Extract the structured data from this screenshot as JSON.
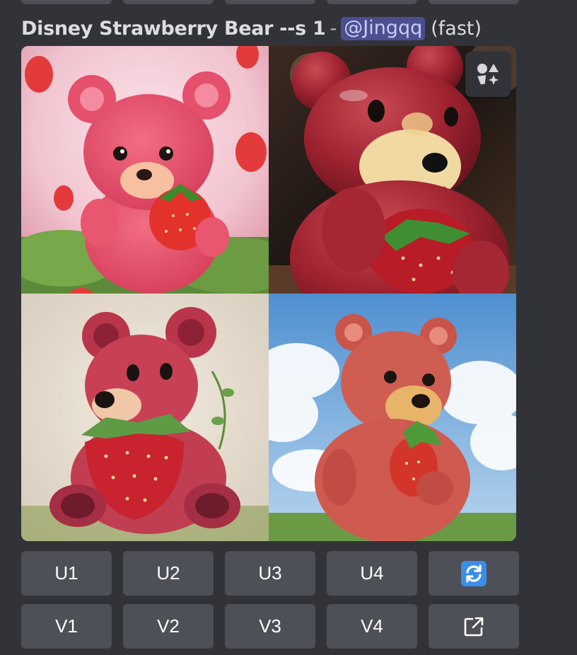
{
  "message": {
    "prompt": "Disney Strawberry Bear --s 1",
    "separator": "-",
    "mention": "@Jingqq",
    "speed": "(fast)"
  },
  "image_grid": {
    "tiles": [
      {
        "name": "fluffy-pink-bear-in-strawberry-field"
      },
      {
        "name": "glossy-ceramic-bear-figurine"
      },
      {
        "name": "strawberry-textured-cartoon-bear"
      },
      {
        "name": "painted-bear-under-blue-sky"
      }
    ],
    "open_icon": "image-grid-icon"
  },
  "buttons": {
    "upscale": [
      "U1",
      "U2",
      "U3",
      "U4"
    ],
    "variation": [
      "V1",
      "V2",
      "V3",
      "V4"
    ],
    "reroll_icon": "reroll-icon",
    "web_icon": "open-external-icon"
  },
  "colors": {
    "background": "#313338",
    "button": "#4e5058",
    "mention_bg": "#4b4f8e",
    "reroll_blue": "#3b8ee8"
  }
}
